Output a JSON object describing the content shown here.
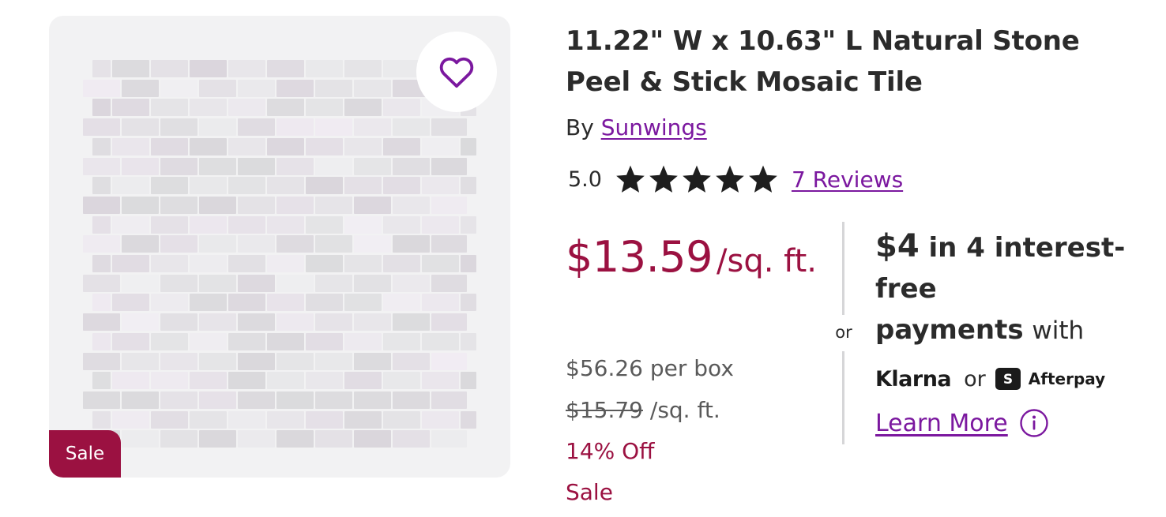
{
  "product": {
    "title": "11.22\" W x 10.63\" L Natural Stone Peel & Stick Mosaic Tile",
    "by_prefix": "By",
    "brand": "Sunwings",
    "image_badge": "Sale",
    "favorite_icon": "heart-outline-icon"
  },
  "rating": {
    "value": "5.0",
    "stars": 5,
    "reviews_label": "7 Reviews"
  },
  "pricing": {
    "price": "$13.59",
    "unit": "/sq. ft.",
    "per_box": "$56.26 per box",
    "was_price": "$15.79",
    "was_unit": "/sq. ft.",
    "discount": "14% Off",
    "sale_label": "Sale"
  },
  "divider": {
    "or_text": "or"
  },
  "installments": {
    "amount": "$4",
    "line1_rest": "in 4 interest-free",
    "line2_bold": "payments",
    "line2_rest": "with",
    "provider1": "Klarna",
    "providers_or": "or",
    "provider2": "Afterpay",
    "learn_more": "Learn More",
    "info_icon": "info-circle-icon"
  },
  "colors": {
    "sale_red": "#9b1141",
    "link_purple": "#7b189f",
    "heart_purple": "#7b189f",
    "text_dark": "#2b2b2b",
    "image_bg": "#f2f2f3"
  }
}
